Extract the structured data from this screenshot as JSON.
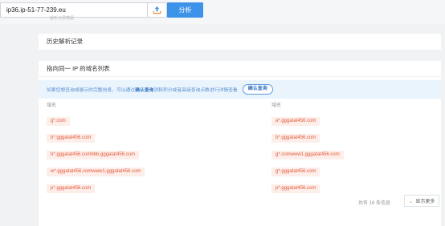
{
  "search": {
    "value": "ip36.ip-51-77-239.eu",
    "analyze_label": "分析",
    "upload_icon": "upload-icon"
  },
  "faint_text": "解析记录截图",
  "history": {
    "title": "历史解析记录"
  },
  "domains": {
    "title": "指向同一 IP 的域名列表",
    "notice": "如果您想查询或展示的完整信息，可以通过",
    "notice_bold": "确认查询",
    "notice_tail": "消耗积分或者高级查询点数进行详情查看",
    "confirm_label": "确认查询",
    "left_header": "域名",
    "right_header": "域名",
    "left": [
      "g*.com",
      "b*.gggatat456.com",
      "b*.gggatat456.combbb.gggatat456.com",
      "w*.gggatat456.comwww1.gggatat456.com",
      "p*.gggatat456.com"
    ],
    "right": [
      "a*.gggatat456.com",
      "b*.gggatat456.com",
      "g*.comwww1.gggatat456.com",
      "g*.gggatat456.com",
      "p*.gggatat456.com"
    ],
    "count_text": "共有 16 条信息",
    "more_label": "显示更多"
  },
  "colors": {
    "accent": "#3d92e9",
    "tag_text": "#e35a3b",
    "tag_bg": "#fdeeea"
  }
}
